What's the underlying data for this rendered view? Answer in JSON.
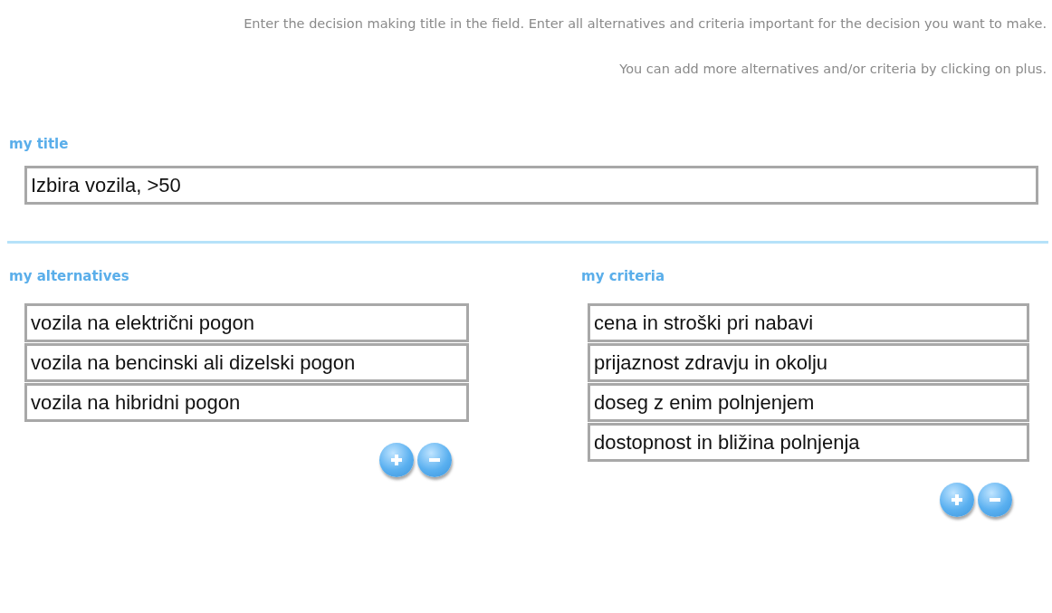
{
  "instructions": [
    "Enter the decision making title in the field. Enter all alternatives and criteria important for the decision you want to make.",
    "You can add more alternatives and/or criteria by clicking on plus."
  ],
  "title_section": {
    "label": "my title",
    "value": "Izbira vozila, >50"
  },
  "alternatives": {
    "label": "my alternatives",
    "items": [
      {
        "value": "vozila na električni pogon"
      },
      {
        "value": "vozila na bencinski ali dizelski pogon"
      },
      {
        "value": "vozila na hibridni pogon"
      }
    ]
  },
  "criteria": {
    "label": "my criteria",
    "items": [
      {
        "value": "cena in stroški pri nabavi"
      },
      {
        "value": "prijaznost zdravju in okolju"
      },
      {
        "value": "doseg z enim polnjenjem"
      },
      {
        "value": "dostopnost in bližina polnjenja"
      }
    ]
  }
}
